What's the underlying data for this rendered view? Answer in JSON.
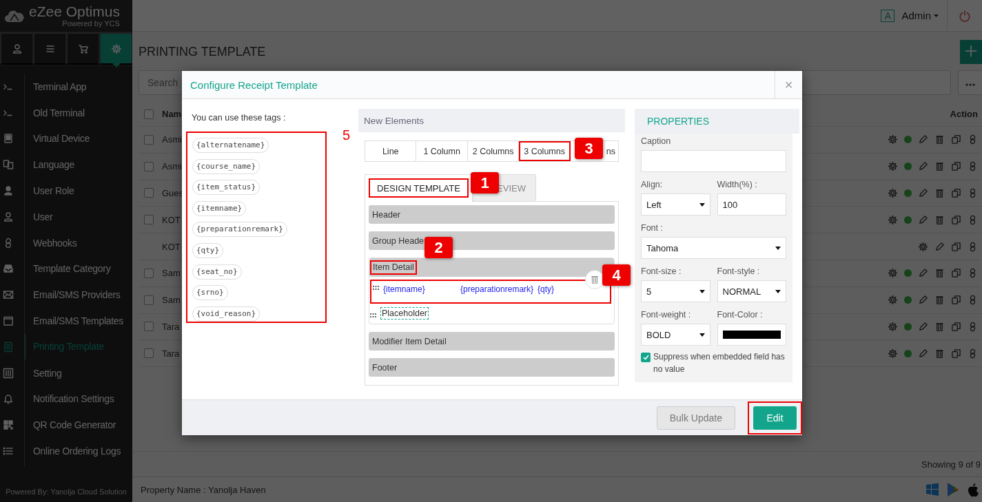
{
  "brand": {
    "name": "eZee Optimus",
    "tagline": "Powered by YCS"
  },
  "nav_tabs": [
    {
      "kind": "user",
      "selected": false
    },
    {
      "kind": "menu",
      "selected": false
    },
    {
      "kind": "cart",
      "selected": false
    },
    {
      "kind": "settings",
      "selected": true
    }
  ],
  "menu": [
    {
      "label": "Terminal App",
      "kind": "terminal",
      "selected": false
    },
    {
      "label": "Old Terminal",
      "kind": "terminal",
      "selected": false
    },
    {
      "label": "Virtual Device",
      "kind": "tablet",
      "selected": false
    },
    {
      "label": "Language",
      "kind": "language",
      "selected": false
    },
    {
      "label": "User Role",
      "kind": "person",
      "selected": false
    },
    {
      "label": "User",
      "kind": "user",
      "selected": false
    },
    {
      "label": "Webhooks",
      "kind": "link",
      "selected": false
    },
    {
      "label": "Template Category",
      "kind": "tray",
      "selected": false
    },
    {
      "label": "Email/SMS Providers",
      "kind": "mail",
      "selected": false
    },
    {
      "label": "Email/SMS Templates",
      "kind": "calendar",
      "selected": false
    },
    {
      "label": "Printing Template",
      "kind": "receipt",
      "selected": true
    },
    {
      "label": "Setting",
      "kind": "sliders",
      "selected": false
    },
    {
      "label": "Notification Settings",
      "kind": "bell",
      "selected": false
    },
    {
      "label": "QR Code Generator",
      "kind": "qr",
      "selected": false
    },
    {
      "label": "Online Ordering Logs",
      "kind": "list",
      "selected": false
    }
  ],
  "sidebar_footer": "Powered By: Yanolja Cloud Solution",
  "topbar": {
    "avatar": "A",
    "user": "Admin"
  },
  "page": {
    "title": "PRINTING TEMPLATE",
    "search": {
      "placeholder": "Search"
    }
  },
  "table": {
    "columns": [
      "Nam",
      "Action"
    ],
    "select_all": {
      "checked": false
    },
    "rows": [
      {
        "name": "Asmi",
        "kind": "custom",
        "checked": false
      },
      {
        "name": "Asmi",
        "kind": "custom",
        "checked": false
      },
      {
        "name": "Gues",
        "kind": "custom",
        "checked": false
      },
      {
        "name": "KOT",
        "kind": "custom",
        "checked": false
      },
      {
        "name": "KOT",
        "kind": "system"
      },
      {
        "name": "Sam",
        "kind": "custom",
        "checked": false
      },
      {
        "name": "Sam",
        "kind": "custom",
        "checked": false
      },
      {
        "name": "Tara",
        "kind": "custom",
        "checked": false
      },
      {
        "name": "Tara",
        "kind": "custom",
        "checked": false
      }
    ]
  },
  "status": "Showing 9 of 9",
  "footer": {
    "property": "Property Name : Yanolja Haven"
  },
  "modal": {
    "title": "Configure Receipt Template",
    "close": "×",
    "tags_label": "You can use these tags :",
    "tags_highlighted": true,
    "tags": [
      "{alternatename}",
      "{course_name}",
      "{item_status}",
      "{itemname}",
      "{preparationremark}",
      "{qty}",
      "{seat_no}",
      "{srno}",
      "{void_reason}"
    ],
    "new_elements": {
      "title": "New Elements",
      "items": [
        {
          "label": "Line",
          "highlighted": false
        },
        {
          "label": "1 Column",
          "highlighted": false
        },
        {
          "label": "2 Columns",
          "highlighted": false
        },
        {
          "label": "3 Columns",
          "highlighted": true
        },
        {
          "label": "ns",
          "highlighted": false
        }
      ]
    },
    "tabs": [
      {
        "label": "DESIGN TEMPLATE",
        "selected": true,
        "highlighted": true
      },
      {
        "label": "EVIEW",
        "selected": false,
        "highlighted": false
      }
    ],
    "sections": [
      {
        "label": "Header",
        "expanded": false,
        "highlighted": false
      },
      {
        "label": "Group Heade",
        "expanded": false,
        "highlighted": false
      },
      {
        "label": "Item Detail",
        "expanded": true,
        "highlighted": true,
        "rows": [
          {
            "kind": "columns",
            "highlighted": true,
            "cells": [
              "{itemname}",
              "{preparationremark}",
              "{qty}"
            ]
          },
          {
            "kind": "placeholder",
            "label": "Placeholder"
          }
        ]
      },
      {
        "label": "Modifier Item Detail",
        "expanded": false,
        "highlighted": false
      },
      {
        "label": "Footer",
        "expanded": false,
        "highlighted": false
      }
    ],
    "properties": {
      "title": "PROPERTIES",
      "rows": [
        [
          {
            "label": "Caption",
            "kind": "text"
          }
        ],
        [
          {
            "label": "Align:",
            "kind": "select",
            "value": "Left"
          },
          {
            "label": "Width(%) :",
            "kind": "text",
            "value": "100"
          }
        ],
        [
          {
            "label": "Font :",
            "kind": "select",
            "value": "Tahoma"
          }
        ],
        [
          {
            "label": "Font-size :",
            "kind": "select",
            "value": "5"
          },
          {
            "label": "Font-style :",
            "kind": "select",
            "value": "NORMAL"
          }
        ],
        [
          {
            "label": "Font-weight :",
            "kind": "select",
            "value": "BOLD"
          },
          {
            "label": "Font-Color :",
            "kind": "color",
            "color": "#000000"
          }
        ]
      ],
      "checkbox": {
        "label": "Suppress when embedded field has no value",
        "checked": true
      }
    },
    "buttons": [
      {
        "label": "Bulk Update",
        "kind": "secondary",
        "highlighted": false
      },
      {
        "label": "Edit",
        "kind": "primary",
        "highlighted": true
      }
    ]
  },
  "callouts": [
    {
      "label": "1",
      "kind": "badge"
    },
    {
      "label": "2",
      "kind": "badge"
    },
    {
      "label": "3",
      "kind": "badge"
    },
    {
      "label": "4",
      "kind": "badge"
    },
    {
      "label": "5",
      "kind": "plain"
    }
  ]
}
